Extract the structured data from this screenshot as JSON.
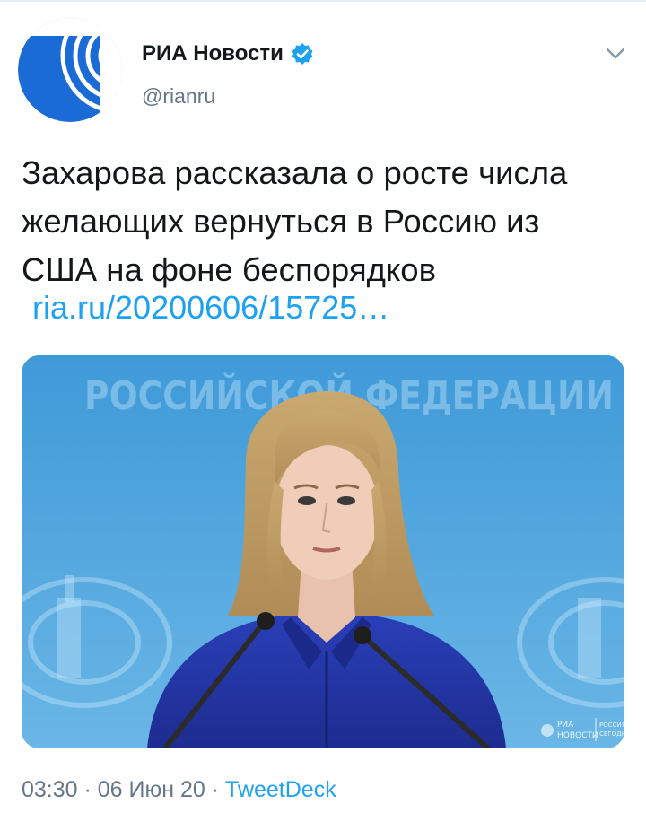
{
  "account": {
    "display_name": "РИА Новости",
    "handle": "@rianru",
    "avatar_icon": "ria-logo-icon",
    "verified_icon": "verified-badge-icon",
    "menu_icon": "chevron-down-icon"
  },
  "tweet": {
    "text_lines": [
      "Захарова рассказала о росте числа",
      "желающих вернуться в Россию из",
      "США на фоне беспорядков"
    ],
    "link": "ria.ru/20200606/15725…",
    "media": {
      "backdrop_text": "РОССИЙСКОЙ ФЕДЕРАЦИИ",
      "watermark_left": "РИА\nНОВОСТИ",
      "watermark_right": "РОССИЯ\nСЕГОДНЯ"
    }
  },
  "meta": {
    "time": "03:30",
    "sep1": " · ",
    "date": "06 Июн 20",
    "sep2": " · ",
    "source": "TweetDeck"
  },
  "colors": {
    "accent": "#1da1f2",
    "secondary_text": "#657786",
    "logo_blue": "#1b6bd6"
  }
}
